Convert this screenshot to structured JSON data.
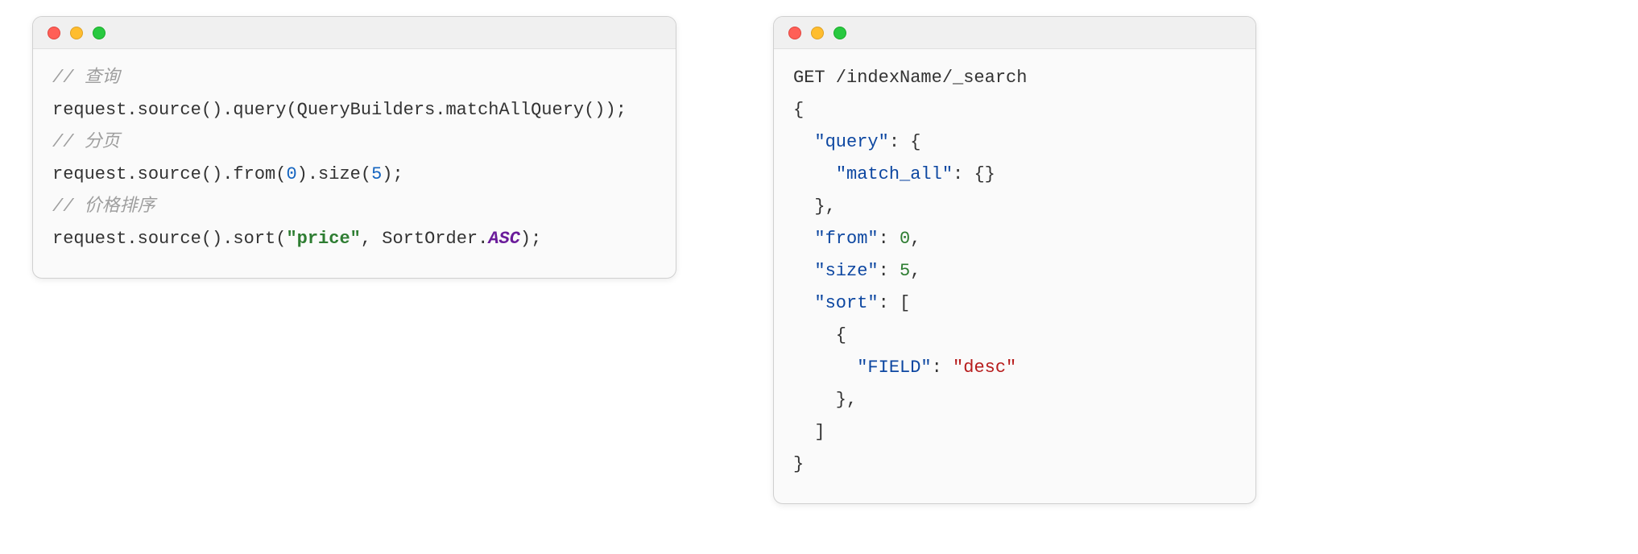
{
  "left": {
    "comment1": "// 查询",
    "line1_a": "request.source().query(QueryBuilders.matchAllQuery());",
    "comment2": "// 分页",
    "line2_a": "request.source().from(",
    "line2_num0": "0",
    "line2_b": ").size(",
    "line2_num5": "5",
    "line2_c": ");",
    "comment3": "// 价格排序",
    "line3_a": "request.source().sort(",
    "line3_str": "\"price\"",
    "line3_b": ", SortOrder.",
    "line3_enum": "ASC",
    "line3_c": ");"
  },
  "right": {
    "l1": "GET /indexName/_search",
    "l2": "{",
    "l3_indent": "  ",
    "l3_key": "\"query\"",
    "l3_rest": ": {",
    "l4_indent": "    ",
    "l4_key": "\"match_all\"",
    "l4_rest": ": {}",
    "l5": "  },",
    "l6_indent": "  ",
    "l6_key": "\"from\"",
    "l6_colon": ": ",
    "l6_val": "0",
    "l6_comma": ",",
    "l7_indent": "  ",
    "l7_key": "\"size\"",
    "l7_colon": ": ",
    "l7_val": "5",
    "l7_comma": ",",
    "l8_indent": "  ",
    "l8_key": "\"sort\"",
    "l8_rest": ": [",
    "l9": "    {",
    "l10_indent": "      ",
    "l10_key": "\"FIELD\"",
    "l10_colon": ": ",
    "l10_val": "\"desc\"",
    "l11": "    },",
    "l12": "  ]",
    "l13": "}"
  }
}
